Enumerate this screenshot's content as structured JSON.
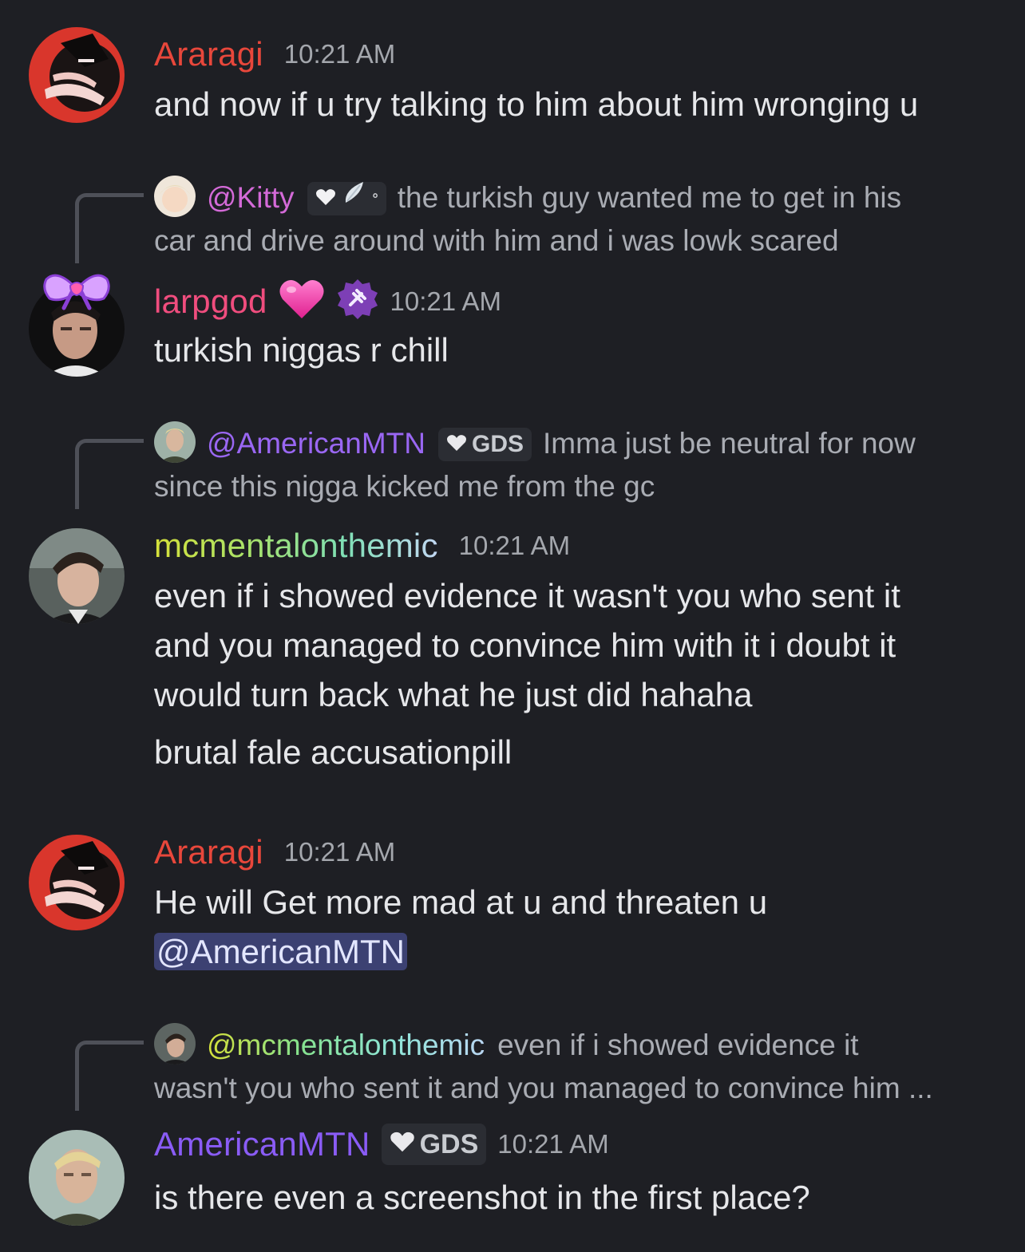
{
  "colors": {
    "background": "#1e1f24",
    "araragi": "#e8473b",
    "larpgod": "#f04d7e",
    "americanmtn": "#8a5cf6",
    "mention_bg": "#3c4172",
    "timestamp": "#a4a7ad"
  },
  "messages": [
    {
      "username": "Araragi",
      "timestamp": "10:21 AM",
      "lines": [
        "and now if u try talking to him about him wronging u"
      ]
    },
    {
      "reply": {
        "name": "@Kitty",
        "tag_icons": [
          "heart-icon",
          "wing-icon"
        ],
        "text_line1": "the turkish guy wanted me to get in his",
        "text_line2": "car and drive around with him and i was lowk scared"
      },
      "username": "larpgod",
      "username_emoji": "heart-emoji",
      "badge_icon": "server-badge-icon",
      "timestamp": "10:21 AM",
      "lines": [
        "turkish niggas r chill"
      ]
    },
    {
      "reply": {
        "name": "@AmericanMTN",
        "tag_label": "GDS",
        "text_line1": "Imma just be neutral for now",
        "text_line2": "since this nigga kicked me from the gc"
      },
      "username": "mcmentalonthemic",
      "timestamp": "10:21 AM",
      "lines": [
        "even if i showed evidence it wasn't you who sent it",
        "and you managed to convince him with it i doubt it",
        "would turn back what he just did hahaha"
      ],
      "extra_line": "brutal fale accusationpill"
    },
    {
      "username": "Araragi",
      "timestamp": "10:21 AM",
      "lines": [
        "He will Get more mad at u and threaten u"
      ],
      "mention": "@AmericanMTN"
    },
    {
      "reply": {
        "name": "@mcmentalonthemic",
        "text_line1": "even if i showed evidence it",
        "text_line2": "wasn't you who sent it and you managed to convince him ..."
      },
      "username": "AmericanMTN",
      "tag_label": "GDS",
      "timestamp": "10:21 AM",
      "lines": [
        "is there even a screenshot in the first place?"
      ]
    }
  ]
}
